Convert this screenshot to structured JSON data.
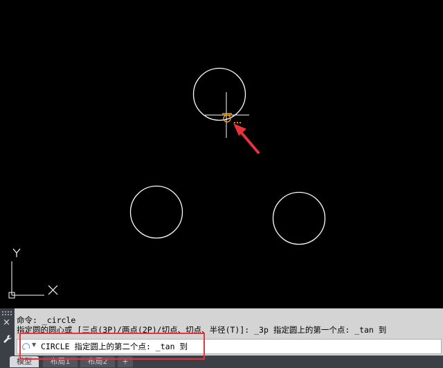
{
  "command_line": {
    "history": [
      "命令: _circle",
      "指定圆的圆心或 [三点(3P)/两点(2P)/切点、切点、半径(T)]: _3p 指定圆上的第一个点: _tan 到"
    ],
    "current_input": "CIRCLE 指定圆上的第二个点: _tan 到",
    "close_glyph": "×"
  },
  "layout_tabs": [
    {
      "label": "模型",
      "active": true
    },
    {
      "label": "布局1",
      "active": false
    },
    {
      "label": "布局2",
      "active": false
    },
    {
      "label": "+",
      "active": false
    }
  ],
  "ucs_icon": {
    "x_label": "X",
    "y_label": "Y"
  },
  "colors": {
    "canvas_bg": "#000000",
    "entity": "#ffffff",
    "snap_marker": "#f0a020",
    "annotation": "#e8333a"
  }
}
